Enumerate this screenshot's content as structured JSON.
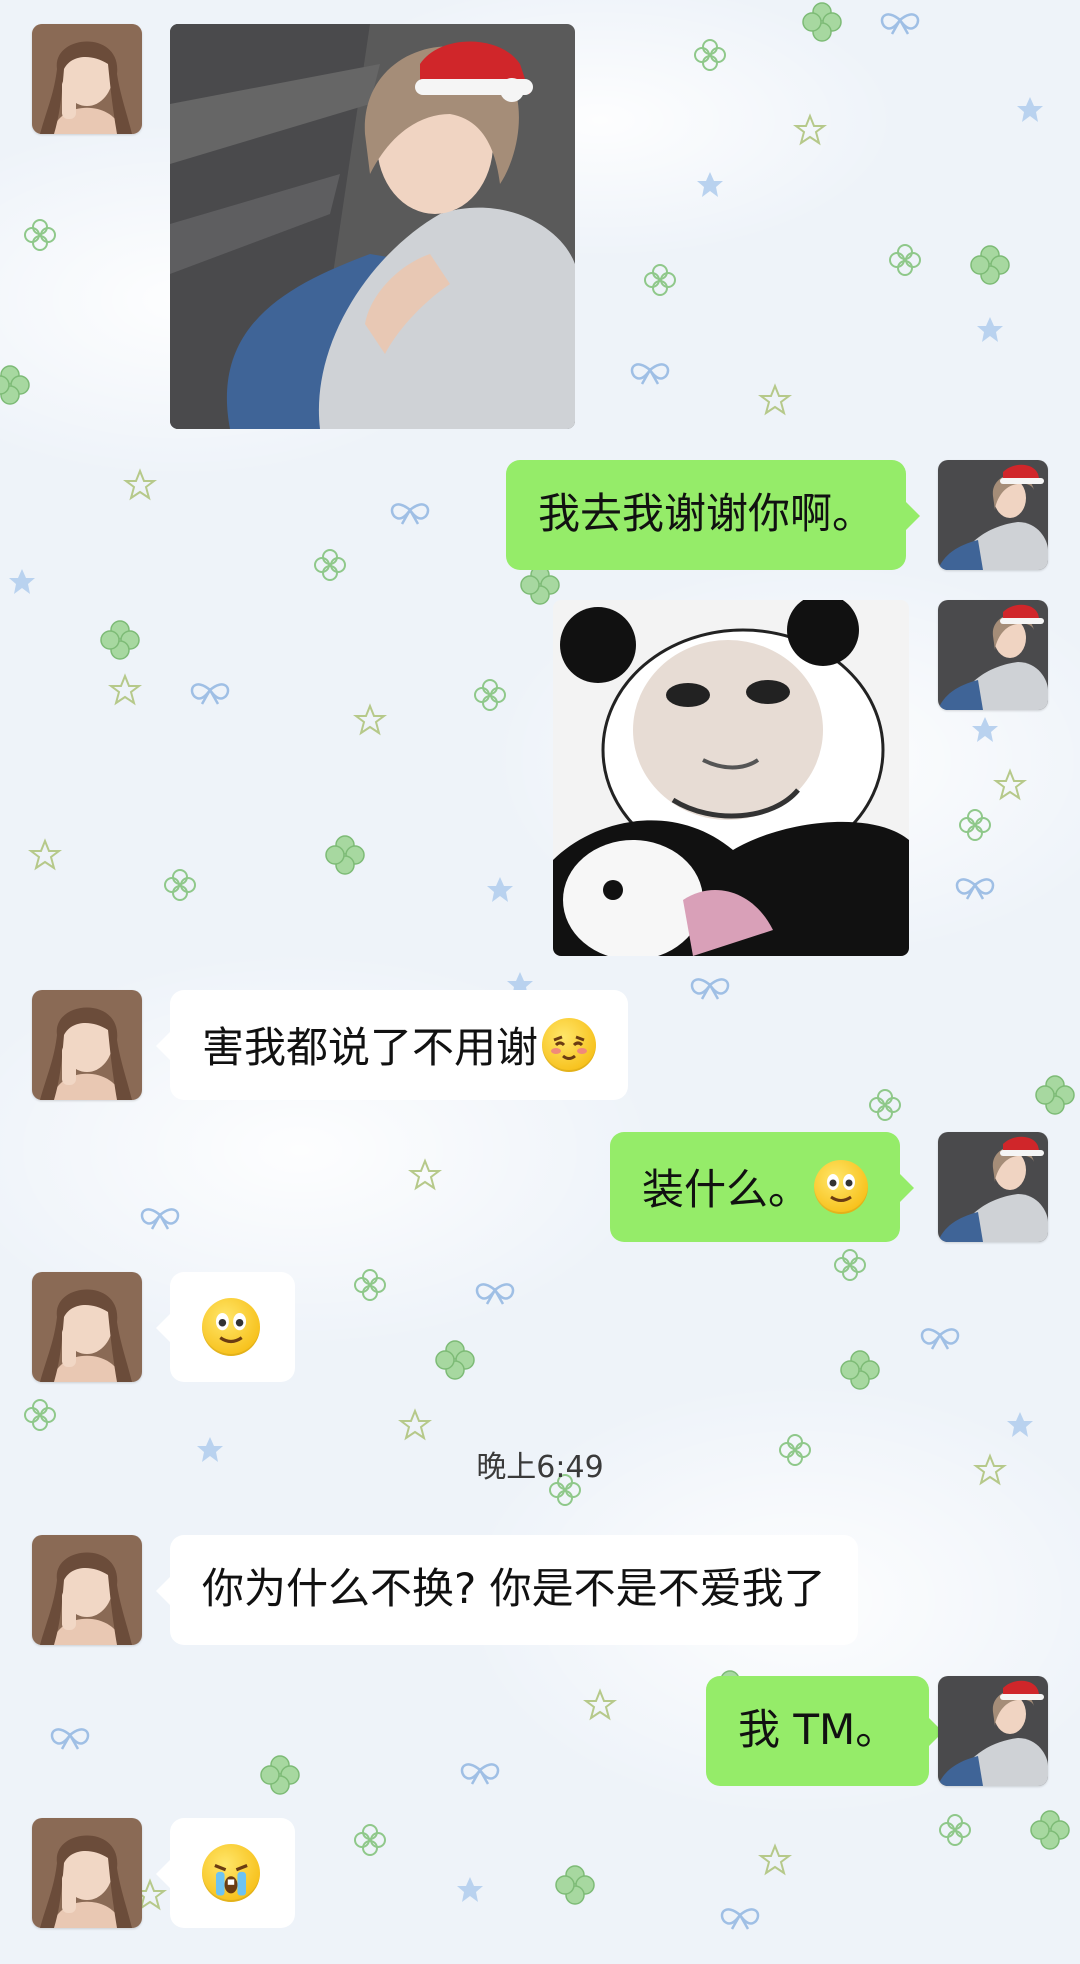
{
  "messages": [
    {
      "side": "in",
      "type": "image",
      "alt_icon": "photo-boy-santa-hat"
    },
    {
      "side": "out",
      "type": "text",
      "text": "我去我谢谢你啊。"
    },
    {
      "side": "out",
      "type": "image",
      "alt_icon": "panda-face-meme"
    },
    {
      "side": "in",
      "type": "text",
      "text": "害我都说了不用谢",
      "emoji": "shy-smile-emoji"
    },
    {
      "side": "out",
      "type": "text",
      "text": "装什么。",
      "emoji": "smile-emoji"
    },
    {
      "side": "in",
      "type": "emoji",
      "emoji": "smile-emoji"
    },
    {
      "side": "in",
      "type": "text",
      "text": "你为什么不换? 你是不是不爱我了"
    },
    {
      "side": "out",
      "type": "text",
      "text": "我 TM。"
    },
    {
      "side": "in",
      "type": "emoji",
      "emoji": "crying-emoji"
    }
  ],
  "timestamp": "晚上6:49",
  "colors": {
    "outgoing_bubble": "#95ec69",
    "incoming_bubble": "#ffffff",
    "background": "#eef3f9",
    "clover": "#9fd39a",
    "star": "#a9c6ea"
  },
  "avatars": {
    "contact": "contact-avatar-woman",
    "self": "self-avatar-boy-santa-hat"
  }
}
